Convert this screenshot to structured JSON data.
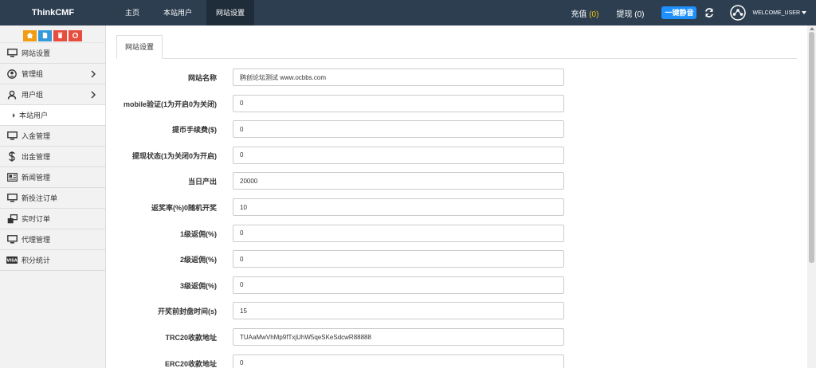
{
  "header": {
    "brand": "ThinkCMF",
    "nav": [
      {
        "label": "主页"
      },
      {
        "label": "本站用户"
      },
      {
        "label": "网站设置"
      }
    ],
    "recharge": {
      "label": "充值",
      "count": "(0)"
    },
    "withdraw": {
      "label": "提现",
      "count": "(0)"
    },
    "mute_label": "一键静音",
    "username": "WELCOME_USER"
  },
  "sidebar": {
    "items": [
      {
        "label": "网站设置"
      },
      {
        "label": "管理组"
      },
      {
        "label": "用户组"
      },
      {
        "label": "本站用户"
      },
      {
        "label": "入金管理"
      },
      {
        "label": "出金管理"
      },
      {
        "label": "新闻管理"
      },
      {
        "label": "新投注订单"
      },
      {
        "label": "实时订单"
      },
      {
        "label": "代理管理"
      },
      {
        "label": "积分统计"
      }
    ]
  },
  "main": {
    "tab_label": "网站设置",
    "fields": [
      {
        "label": "网站名称",
        "value": "鸥创论坛测试 www.ocbbs.com"
      },
      {
        "label": "mobile验证(1为开启0为关闭)",
        "value": "0"
      },
      {
        "label": "提币手续费($)",
        "value": "0"
      },
      {
        "label": "提现状态(1为关闭0为开启)",
        "value": "0"
      },
      {
        "label": "当日产出",
        "value": "20000"
      },
      {
        "label": "返奖率(%)0随机开奖",
        "value": "10"
      },
      {
        "label": "1级返佣(%)",
        "value": "0"
      },
      {
        "label": "2级返佣(%)",
        "value": "0"
      },
      {
        "label": "3级返佣(%)",
        "value": "0"
      },
      {
        "label": "开奖前封盘时间(s)",
        "value": "15"
      },
      {
        "label": "TRC20收款地址",
        "value": "TUAaMwVhMp9fTxjUhW5qeSKeSdcwR88888"
      },
      {
        "label": "ERC20收款地址",
        "value": "0"
      }
    ]
  },
  "colors": {
    "topbar": "#2c3e50",
    "accent_blue": "#1e90ff",
    "count_yellow": "#f1c40f",
    "shortcut_orange": "#f39c12",
    "shortcut_blue": "#3498db",
    "shortcut_red": "#e74c3c"
  }
}
